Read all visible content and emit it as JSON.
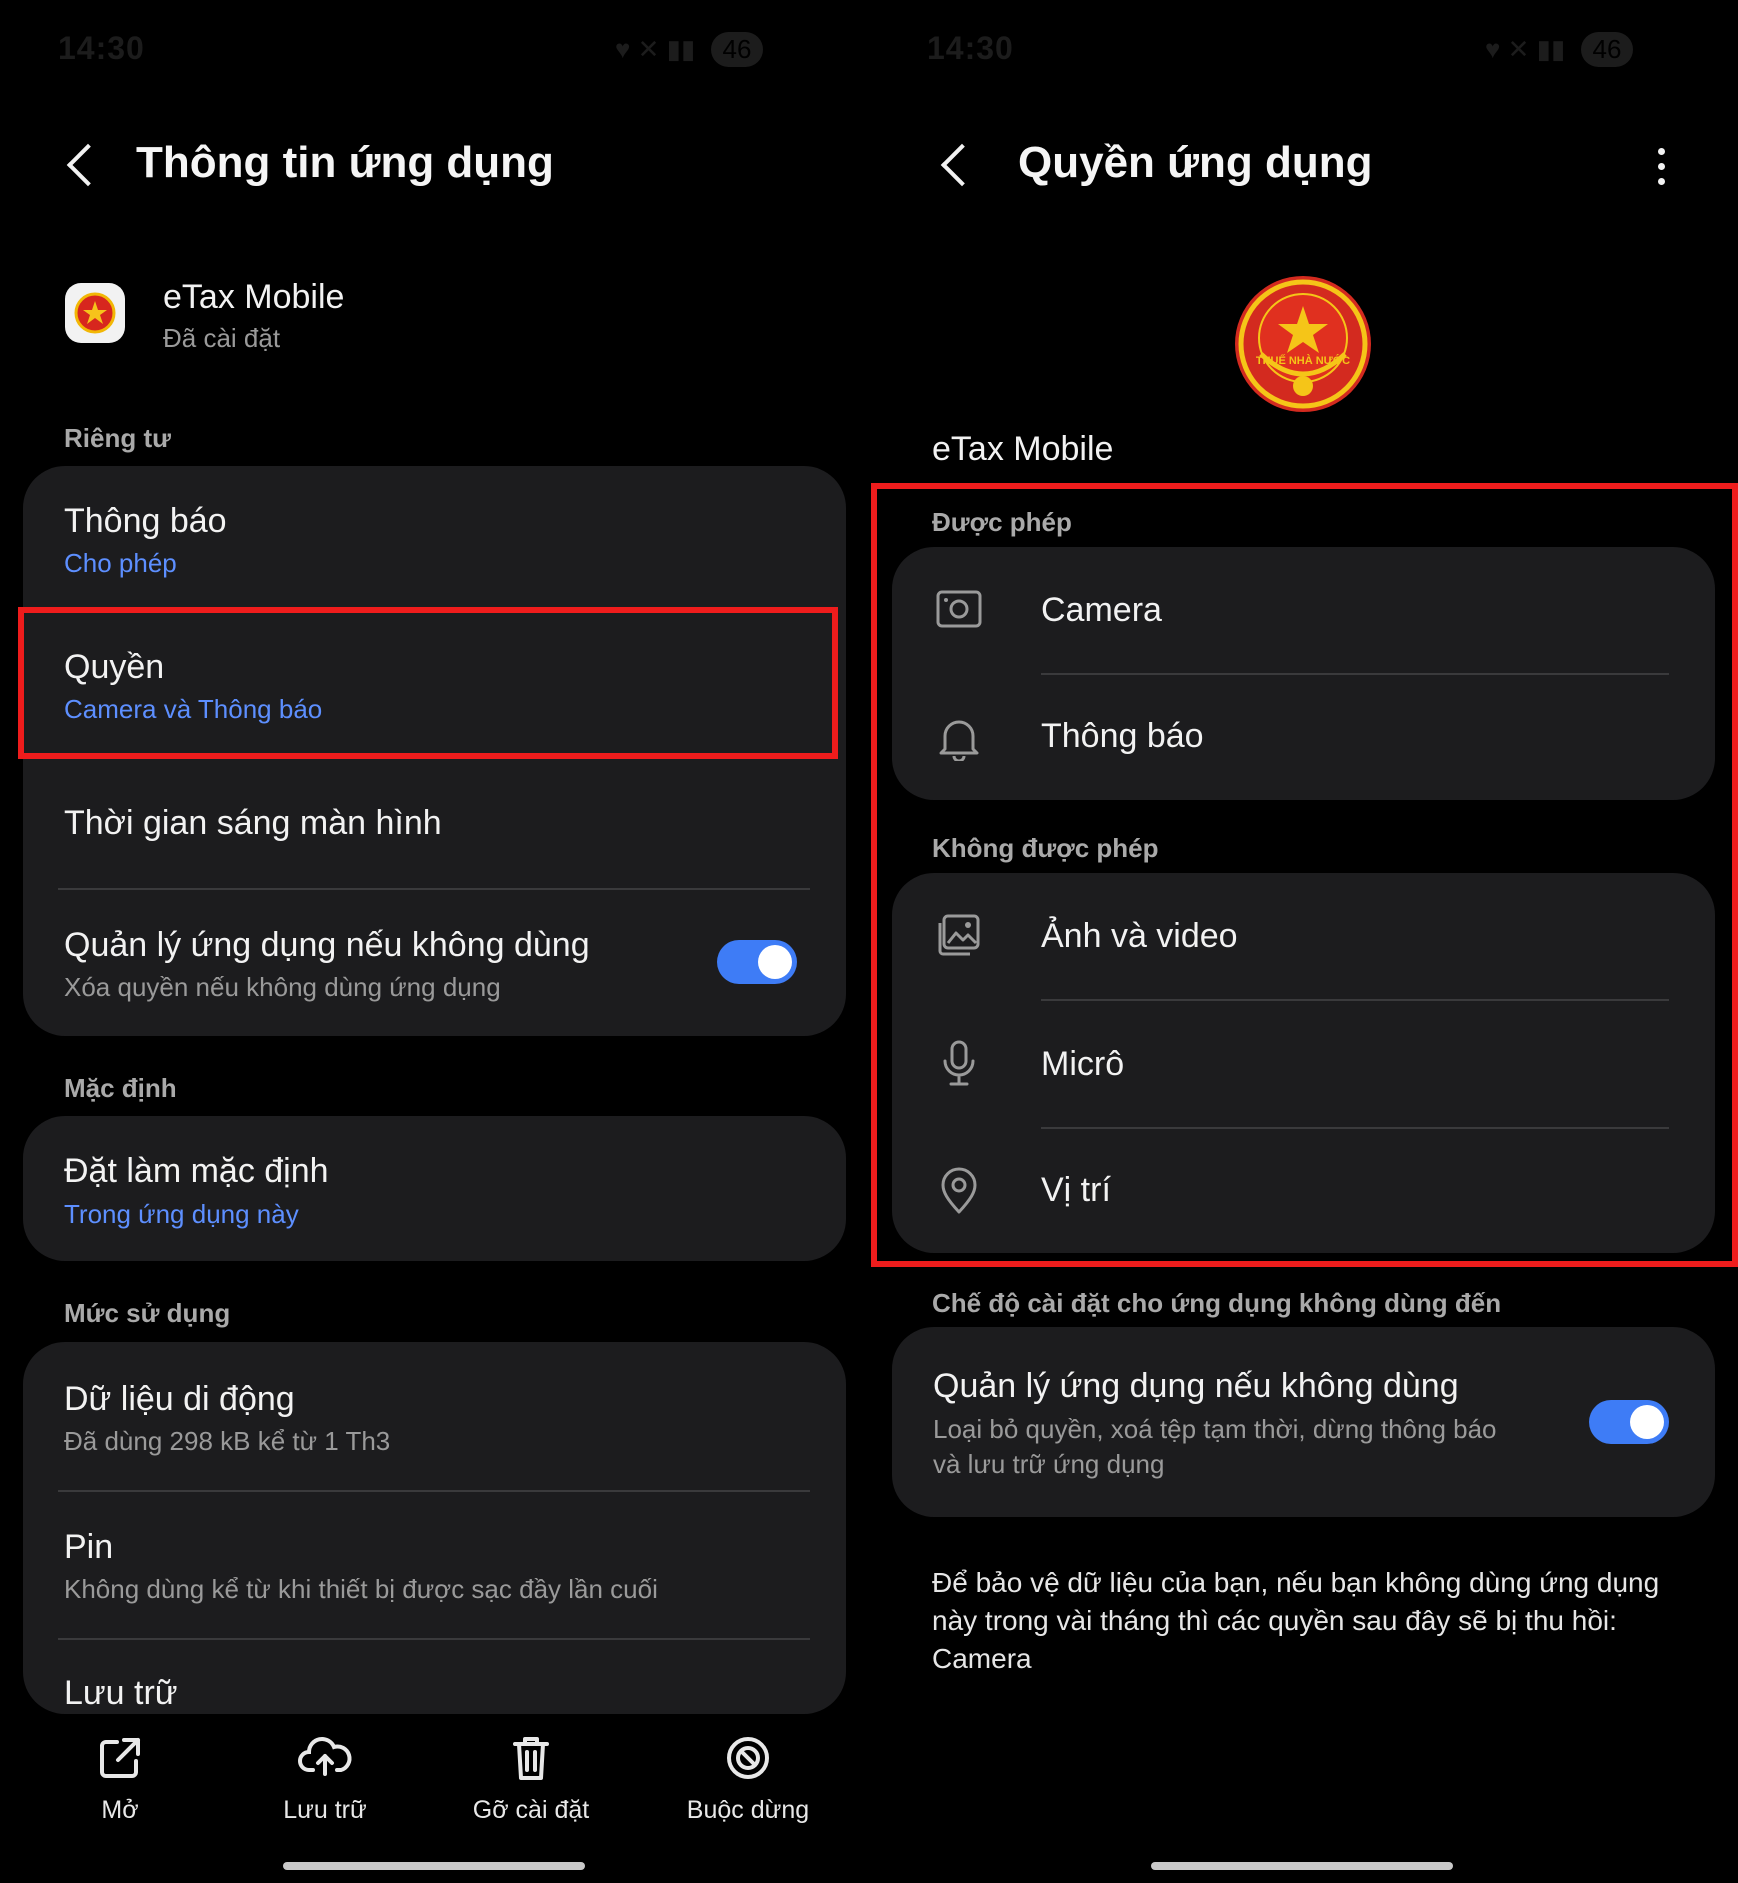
{
  "left": {
    "status": {
      "time": "14:30",
      "battery": "46"
    },
    "header": {
      "title": "Thông tin ứng dụng"
    },
    "app": {
      "name": "eTax Mobile",
      "status": "Đã cài đặt"
    },
    "privacy": {
      "section": "Riêng tư",
      "notifications": {
        "title": "Thông báo",
        "sub": "Cho phép"
      },
      "permissions": {
        "title": "Quyền",
        "sub": "Camera và Thông báo"
      },
      "screen_time": {
        "title": "Thời gian sáng màn hình"
      },
      "manage_unused": {
        "title": "Quản lý ứng dụng nếu không dùng",
        "sub": "Xóa quyền nếu không dùng ứng dụng",
        "enabled": true
      }
    },
    "defaults": {
      "section": "Mặc định",
      "set_default": {
        "title": "Đặt làm mặc định",
        "sub": "Trong ứng dụng này"
      }
    },
    "usage": {
      "section": "Mức sử dụng",
      "mobile_data": {
        "title": "Dữ liệu di động",
        "sub": "Đã dùng 298 kB kể từ 1 Th3"
      },
      "battery": {
        "title": "Pin",
        "sub": "Không dùng kể từ khi thiết bị được sạc đầy lần cuối"
      },
      "storage": {
        "title": "Lưu trữ"
      }
    },
    "bottom_nav": {
      "open": "Mở",
      "archive": "Lưu trữ",
      "uninstall": "Gỡ cài đặt",
      "force_stop": "Buộc dừng"
    }
  },
  "right": {
    "status": {
      "time": "14:30",
      "battery": "46"
    },
    "header": {
      "title": "Quyền ứng dụng"
    },
    "logo_text": "THUẾ NHÀ NƯỚC",
    "app": {
      "name": "eTax Mobile"
    },
    "allowed": {
      "section": "Được phép",
      "items": [
        "Camera",
        "Thông báo"
      ]
    },
    "not_allowed": {
      "section": "Không được phép",
      "items": [
        "Ảnh và video",
        "Micrô",
        "Vị trí"
      ]
    },
    "unused": {
      "section": "Chế độ cài đặt cho ứng dụng không dùng đến",
      "title": "Quản lý ứng dụng nếu không dùng",
      "sub_line1": "Loại bỏ quyền, xoá tệp tạm thời, dừng thông báo",
      "sub_line2": "và lưu trữ ứng dụng",
      "enabled": true
    },
    "note": {
      "line1": "Để bảo vệ dữ liệu của bạn, nếu bạn không dùng ứng dụng",
      "line2": "này trong vài tháng thì các quyền sau đây sẽ bị thu hồi:",
      "line3": "Camera"
    }
  }
}
